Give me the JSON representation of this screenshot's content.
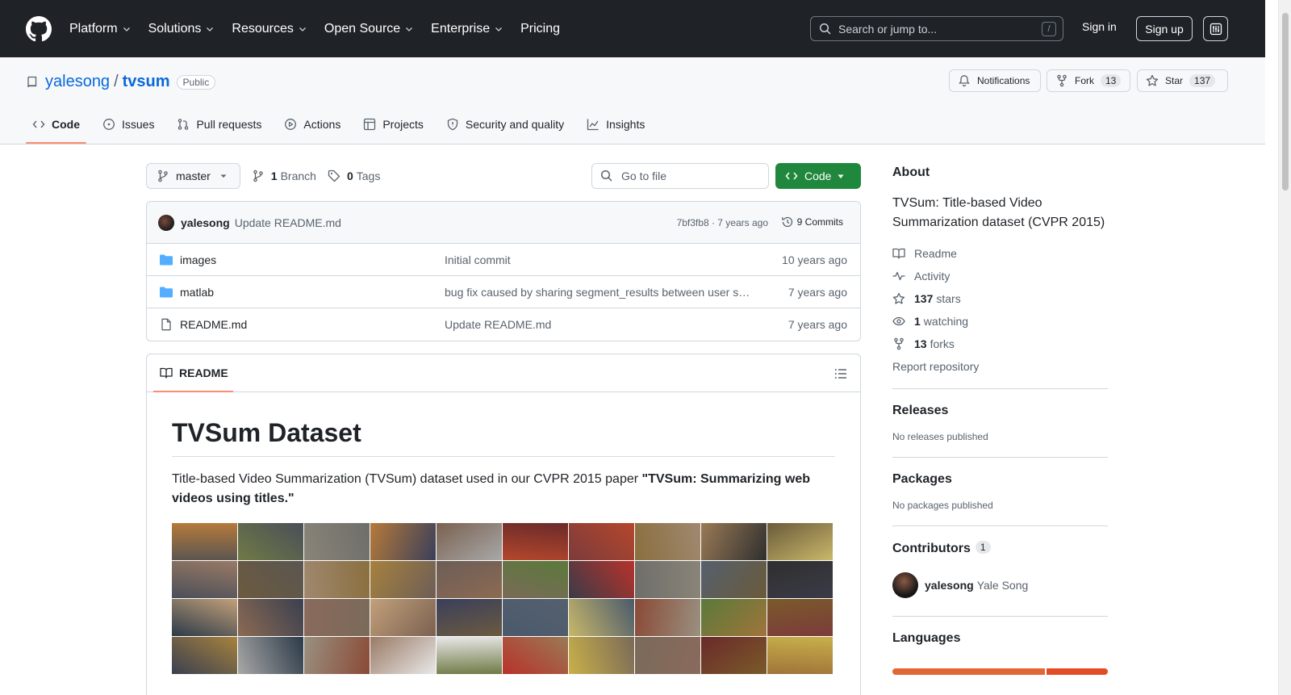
{
  "header": {
    "nav": [
      "Platform",
      "Solutions",
      "Resources",
      "Open Source",
      "Enterprise",
      "Pricing"
    ],
    "search_placeholder": "Search or jump to...",
    "search_shortcut": "/",
    "signin": "Sign in",
    "signup": "Sign up"
  },
  "repo": {
    "owner": "yalesong",
    "separator": "/",
    "name": "tvsum",
    "visibility": "Public",
    "notifications": "Notifications",
    "fork_label": "Fork",
    "fork_count": "13",
    "star_label": "Star",
    "star_count": "137"
  },
  "tabs": [
    "Code",
    "Issues",
    "Pull requests",
    "Actions",
    "Projects",
    "Security and quality",
    "Insights"
  ],
  "toolbar": {
    "branch": "master",
    "branch_count": "1",
    "branch_label": "Branch",
    "tag_count": "0",
    "tag_label": "Tags",
    "goto_placeholder": "Go to file",
    "code_button": "Code"
  },
  "latest_commit": {
    "author": "yalesong",
    "message": "Update README.md",
    "hash_age": "7bf3fb8 · 7 years ago",
    "commits": "9 Commits"
  },
  "files": [
    {
      "name": "images",
      "type": "folder",
      "message": "Initial commit",
      "age": "10 years ago"
    },
    {
      "name": "matlab",
      "type": "folder",
      "message": "bug fix caused by sharing segment_results between user sc…",
      "age": "7 years ago"
    },
    {
      "name": "README.md",
      "type": "file",
      "message": "Update README.md",
      "age": "7 years ago"
    }
  ],
  "readme": {
    "tab_label": "README",
    "title": "TVSum Dataset",
    "intro": "Title-based Video Summarization (TVSum) dataset used in our CVPR 2015 paper ",
    "intro_bold": "\"TVSum: Summarizing web videos using titles.\""
  },
  "sidebar": {
    "about_title": "About",
    "about_desc": "TVSum: Title-based Video Summarization dataset (CVPR 2015)",
    "readme": "Readme",
    "activity": "Activity",
    "stars_count": "137",
    "stars_label": "stars",
    "watching_count": "1",
    "watching_label": "watching",
    "forks_count": "13",
    "forks_label": "forks",
    "report": "Report repository",
    "releases_title": "Releases",
    "releases_empty": "No releases published",
    "packages_title": "Packages",
    "packages_empty": "No packages published",
    "contributors_title": "Contributors",
    "contributors_count": "1",
    "contributor_login": "yalesong",
    "contributor_name": "Yale Song",
    "languages_title": "Languages"
  },
  "colors": {
    "header_bg": "#1f2328",
    "link": "#0969da",
    "primary_button": "#1f883d",
    "active_tab_underline": "#fd8c73",
    "lang_primary": "#e16737",
    "lang_secondary": "#e34c26"
  },
  "thumbnail_colors": [
    "#5b5650",
    "#6f7a45",
    "#8a8478",
    "#b57a3a",
    "#7a6150",
    "#b4472c",
    "#7c3b3c",
    "#8a6f3e",
    "#9a7a55",
    "#6a5a3a",
    "#4a4f58",
    "#6b5a40",
    "#a08870",
    "#a7823d",
    "#6c5d57",
    "#7a6a58",
    "#3b3b48",
    "#6e6e6a",
    "#55606e",
    "#2f2f2f",
    "#2c3a48",
    "#8c6a52",
    "#8a6a5c",
    "#c2a07a",
    "#3a3f5a",
    "#4a5a6c",
    "#c9b86a",
    "#8a4a36",
    "#5a7a3a",
    "#7a5a2a",
    "#3a4050",
    "#a8a8a8",
    "#9a9080",
    "#9a7a65",
    "#e8e8e8",
    "#b8322a",
    "#c8b04a",
    "#7a6a5a",
    "#6a2a2a",
    "#a0743a"
  ]
}
